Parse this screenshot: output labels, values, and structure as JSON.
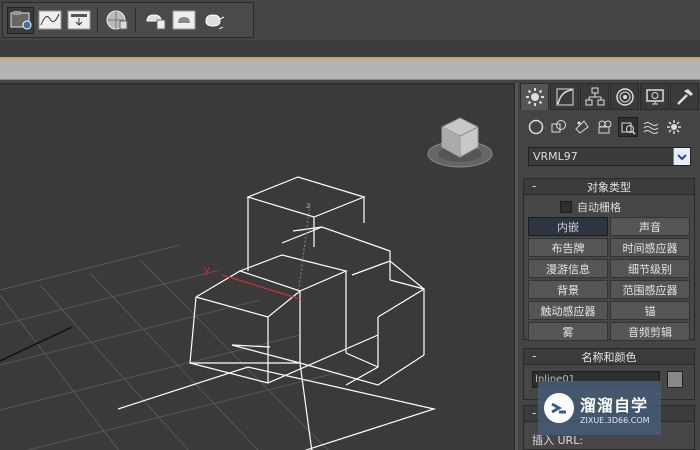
{
  "toolbar": {
    "icons": [
      "scene-converter-icon",
      "curve-editor-icon",
      "export-icon",
      "material-editor-icon",
      "render-setup-icon",
      "rendered-frame-icon",
      "render-teapot-icon"
    ]
  },
  "viewport": {
    "axis_labels": {
      "y": "y",
      "z": "z"
    }
  },
  "command_panel": {
    "tabs": [
      "create-tab",
      "modify-tab",
      "hierarchy-tab",
      "motion-tab",
      "display-tab",
      "utilities-tab"
    ],
    "subcategories": [
      "geometry-icon",
      "shapes-icon",
      "lights-icon",
      "cameras-icon",
      "helpers-icon",
      "space-warps-icon",
      "systems-icon"
    ],
    "category_dropdown": {
      "value": "VRML97"
    },
    "object_type": {
      "title": "对象类型",
      "autogrid_label": "自动栅格",
      "buttons": [
        "内嵌",
        "声音",
        "布告牌",
        "时间感应器",
        "漫游信息",
        "细节级别",
        "背景",
        "范围感应器",
        "触动感应器",
        "锚",
        "雾",
        "音频剪辑"
      ]
    },
    "name_color": {
      "title": "名称和颜色",
      "name_value": "Inline01"
    },
    "third_rollout": {
      "insert_label": "插入 URL:"
    }
  },
  "watermark": {
    "title": "溜溜自学",
    "url": "ZIXUE.3D66.COM"
  },
  "colors": {
    "viewport_bg": "#3a3a3a",
    "wireframe": "#ffffff",
    "y_axis": "#c83232",
    "panel_bg": "#444444",
    "ribbon": "#b4b4b4",
    "accent_gold": "#c8a85a"
  }
}
